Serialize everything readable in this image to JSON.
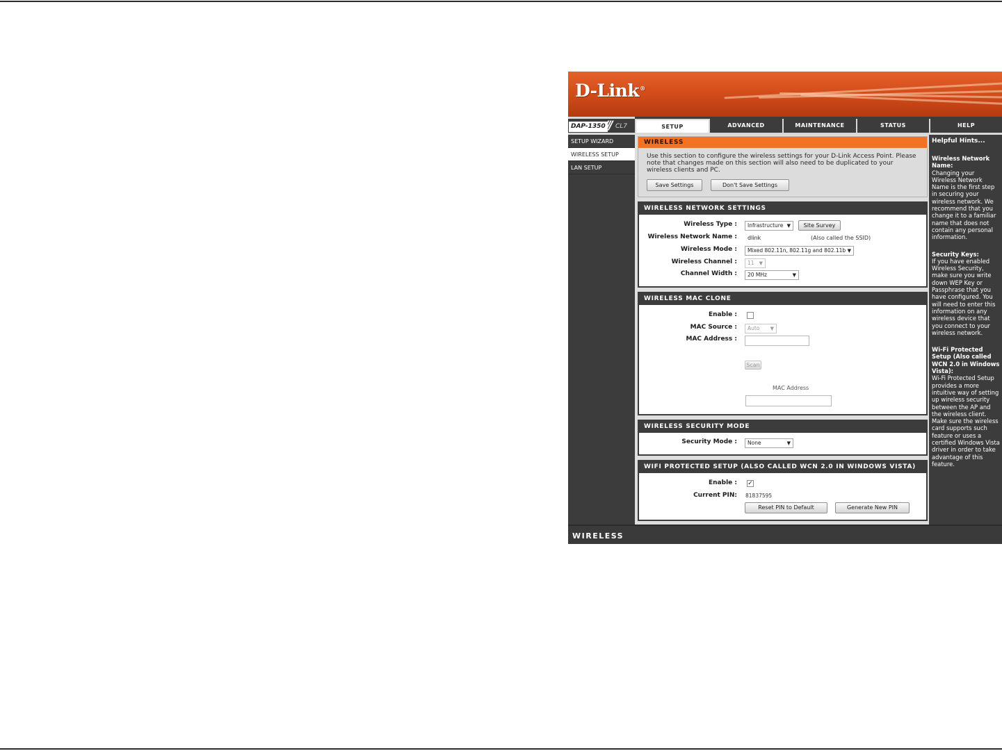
{
  "brand": {
    "logo_text": "D-Link",
    "logo_mark": "®"
  },
  "model": {
    "name": "DAP-1350",
    "hw_version": "CL7"
  },
  "tabs": [
    {
      "label": "SETUP",
      "active": true
    },
    {
      "label": "ADVANCED",
      "active": false
    },
    {
      "label": "MAINTENANCE",
      "active": false
    },
    {
      "label": "STATUS",
      "active": false
    },
    {
      "label": "HELP",
      "active": false
    }
  ],
  "sidebar": {
    "items": [
      {
        "label": "SETUP WIZARD",
        "active": false
      },
      {
        "label": "WIRELESS SETUP",
        "active": true
      },
      {
        "label": "LAN SETUP",
        "active": false
      }
    ]
  },
  "intro": {
    "title": "WIRELESS",
    "text": "Use this section to configure the wireless settings for your D-Link Access Point. Please note that changes made on this section will also need to be duplicated to your wireless clients and PC.",
    "save_label": "Save Settings",
    "dont_save_label": "Don't Save Settings"
  },
  "wireless_network": {
    "title": "WIRELESS NETWORK SETTINGS",
    "type_label": "Wireless Type :",
    "type_value": "Infrastructure",
    "site_survey_label": "Site Survey",
    "ssid_label": "Wireless Network Name :",
    "ssid_value": "dlink",
    "ssid_note": "(Also called the SSID)",
    "mode_label": "Wireless Mode :",
    "mode_value": "Mixed 802.11n, 802.11g and 802.11b",
    "channel_label": "Wireless Channel :",
    "channel_value": "11",
    "width_label": "Channel Width :",
    "width_value": "20 MHz"
  },
  "mac_clone": {
    "title": "WIRELESS MAC CLONE",
    "enable_label": "Enable :",
    "enable_checked": false,
    "source_label": "MAC Source :",
    "source_value": "Auto",
    "address_label": "MAC Address :",
    "address_value": "",
    "scan_label": "Scan",
    "list_header": "MAC Address"
  },
  "security": {
    "title": "WIRELESS SECURITY MODE",
    "mode_label": "Security Mode :",
    "mode_value": "None"
  },
  "wps": {
    "title": "WIFI PROTECTED SETUP (ALSO CALLED WCN 2.0 IN WINDOWS VISTA)",
    "enable_label": "Enable :",
    "enable_checked": true,
    "check_mark": "✓",
    "pin_label": "Current PIN:",
    "pin_value": "81837595",
    "reset_label": "Reset PIN to Default",
    "generate_label": "Generate New PIN"
  },
  "help": {
    "heading": "Helpful Hints...",
    "items": [
      {
        "title": "Wireless Network Name:",
        "text": "Changing your Wireless Network Name is the first step in securing your wireless network. We recommend that you change it to a familiar name that does not contain any personal information."
      },
      {
        "title": "Security Keys:",
        "text": "If you have enabled Wireless Security, make sure you write down WEP Key or Passphrase that you have configured. You will need to enter this information on any wireless device that you connect to your wireless network."
      },
      {
        "title": "Wi-Fi Protected Setup (Also called WCN 2.0 in Windows Vista):",
        "text": "Wi-Fi Protected Setup provides a more intuitive way of setting up wireless security between the AP and the wireless client. Make sure the wireless card supports such feature or uses a certified Windows Vista driver in order to take advantage of this feature."
      }
    ]
  },
  "footer": {
    "label": "WIRELESS"
  },
  "icons": {
    "dropdown": "dropdown-arrow-icon",
    "checkbox": "checkbox-icon"
  },
  "colors": {
    "brand_orange": "#f37325",
    "dark_gray": "#3c3c3c",
    "panel_gray": "#dedede"
  }
}
